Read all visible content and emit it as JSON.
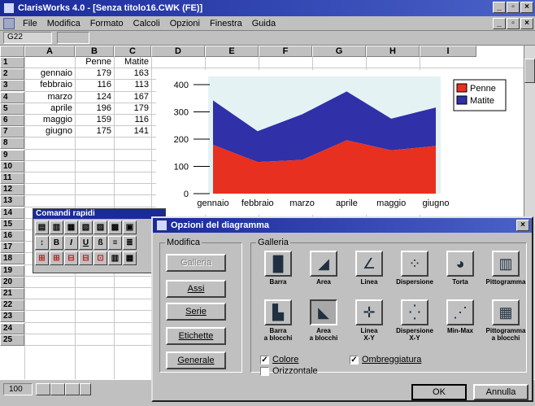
{
  "window": {
    "title": "ClarisWorks 4.0 - [Senza titolo16.CWK (FE)]"
  },
  "menu": [
    "File",
    "Modifica",
    "Formato",
    "Calcoli",
    "Opzioni",
    "Finestra",
    "Guida"
  ],
  "formula_bar": {
    "cell_ref": "G22"
  },
  "sheet": {
    "columns": [
      "A",
      "B",
      "C",
      "D",
      "E",
      "F",
      "G",
      "H",
      "I"
    ],
    "rows": [
      "1",
      "2",
      "3",
      "4",
      "5",
      "6",
      "7",
      "8",
      "9",
      "10",
      "11",
      "12",
      "13",
      "14",
      "15",
      "16",
      "17",
      "18",
      "19",
      "20",
      "21",
      "22",
      "23",
      "24",
      "25"
    ],
    "headers": [
      "Penne",
      "Matite"
    ],
    "data": [
      [
        "gennaio",
        "179",
        "163"
      ],
      [
        "febbraio",
        "116",
        "113"
      ],
      [
        "marzo",
        "124",
        "167"
      ],
      [
        "aprile",
        "196",
        "179"
      ],
      [
        "maggio",
        "159",
        "116"
      ],
      [
        "giugno",
        "175",
        "141"
      ]
    ]
  },
  "chart_data": {
    "type": "area",
    "categories": [
      "gennaio",
      "febbraio",
      "marzo",
      "aprile",
      "maggio",
      "giugno"
    ],
    "series": [
      {
        "name": "Penne",
        "values": [
          179,
          116,
          124,
          196,
          159,
          175
        ],
        "color": "#e83020"
      },
      {
        "name": "Matite",
        "values": [
          163,
          113,
          167,
          179,
          116,
          141
        ],
        "color": "#3030a8"
      }
    ],
    "stacked": true,
    "yticks": [
      "0",
      "100",
      "200",
      "300",
      "400"
    ],
    "ylim": [
      0,
      400
    ],
    "legend": "top-right"
  },
  "palette": {
    "title": "Comandi rapidi"
  },
  "dialog": {
    "title": "Opzioni del diagramma",
    "modifica_label": "Modifica",
    "galleria_label": "Galleria",
    "side_buttons": [
      "Galleria",
      "Assi",
      "Serie",
      "Etichette",
      "Generale"
    ],
    "gallery": [
      [
        "Barra",
        ""
      ],
      [
        "Area",
        ""
      ],
      [
        "Linea",
        ""
      ],
      [
        "Dispersione",
        ""
      ],
      [
        "Torta",
        ""
      ],
      [
        "Pittogramma",
        ""
      ],
      [
        "Barra",
        "a blocchi"
      ],
      [
        "Area",
        "a blocchi"
      ],
      [
        "Linea",
        "X-Y"
      ],
      [
        "Dispersione",
        "X-Y"
      ],
      [
        "Min-Max",
        ""
      ],
      [
        "Pittogramma",
        "a blocchi"
      ]
    ],
    "checkbox_colore": "Colore",
    "checkbox_orizzontale": "Orizzontale",
    "checkbox_ombreggiatura": "Ombreggiatura",
    "ok": "OK",
    "cancel": "Annulla"
  },
  "status": {
    "zoom": "100"
  },
  "colors": {
    "title_bar": "#1a2a9a",
    "penne": "#e83020",
    "matite": "#3030a8"
  }
}
